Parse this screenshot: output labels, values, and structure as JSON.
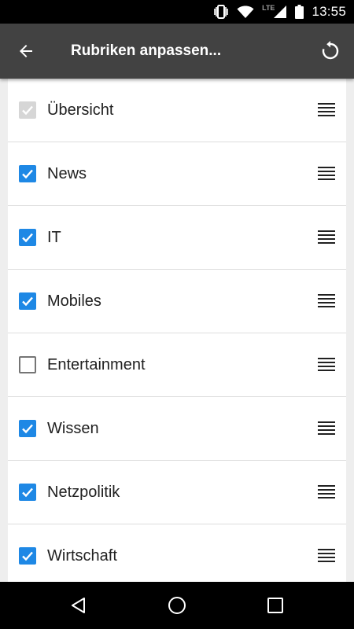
{
  "status_bar": {
    "time": "13:55",
    "network": "LTE",
    "icons": [
      "vibrate-icon",
      "wifi-icon",
      "signal-icon",
      "battery-icon"
    ]
  },
  "app_bar": {
    "title": "Rubriken anpassen...",
    "back_icon": "arrow-left-icon",
    "reset_icon": "refresh-icon",
    "background": "#424242"
  },
  "list": {
    "items": [
      {
        "label": "Übersicht",
        "checked": true,
        "disabled": true
      },
      {
        "label": "News",
        "checked": true,
        "disabled": false
      },
      {
        "label": "IT",
        "checked": true,
        "disabled": false
      },
      {
        "label": "Mobiles",
        "checked": true,
        "disabled": false
      },
      {
        "label": "Entertainment",
        "checked": false,
        "disabled": false
      },
      {
        "label": "Wissen",
        "checked": true,
        "disabled": false
      },
      {
        "label": "Netzpolitik",
        "checked": true,
        "disabled": false
      },
      {
        "label": "Wirtschaft",
        "checked": true,
        "disabled": false
      }
    ],
    "checked_color": "#1e88e5",
    "disabled_color": "#d6d6d6"
  },
  "nav_bar": {
    "icons": [
      "back-triangle-icon",
      "home-circle-icon",
      "recents-square-icon"
    ]
  }
}
